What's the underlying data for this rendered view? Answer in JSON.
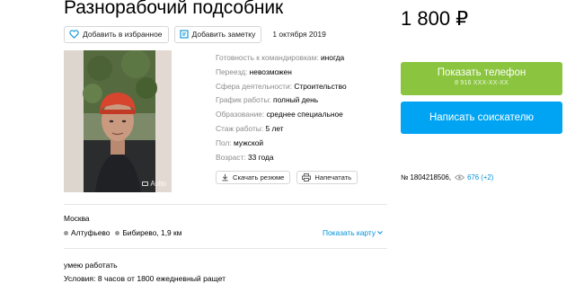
{
  "title": "Разнорабочий подсобник",
  "price": "1 800 ₽",
  "actions": {
    "favorite_label": "Добавить в избранное",
    "note_label": "Добавить заметку",
    "date": "1 октября 2019"
  },
  "photo": {
    "watermark": "Avito"
  },
  "details": [
    {
      "key": "Готовность к командировкам:",
      "value": "иногда"
    },
    {
      "key": "Переезд:",
      "value": "невозможен"
    },
    {
      "key": "Сфера деятельности:",
      "value": "Строительство"
    },
    {
      "key": "График работы:",
      "value": "полный день"
    },
    {
      "key": "Образование:",
      "value": "среднее специальное"
    },
    {
      "key": "Стаж работы:",
      "value": "5 лет"
    },
    {
      "key": "Пол:",
      "value": "мужской"
    },
    {
      "key": "Возраст:",
      "value": "33 года"
    }
  ],
  "resume_actions": {
    "download_label": "Скачать резюме",
    "print_label": "Напечатать"
  },
  "location": {
    "city": "Москва",
    "metros": [
      "Алтуфьево",
      "Бибирево, 1,9 км"
    ],
    "show_map_label": "Показать карту"
  },
  "description": {
    "line1": "умею работать",
    "line2": "Условия: 8 часов от 1800 ежедневный ращет"
  },
  "sidebar": {
    "phone_button_label": "Показать телефон",
    "phone_number_masked": "8 916 XXX-XX-XX",
    "write_button_label": "Написать соискателю",
    "listing_number": "№ 1804218506,",
    "views": "676 (+2)"
  },
  "colors": {
    "green": "#8bc53f",
    "blue": "#00a4f3",
    "link": "#0091d9"
  }
}
